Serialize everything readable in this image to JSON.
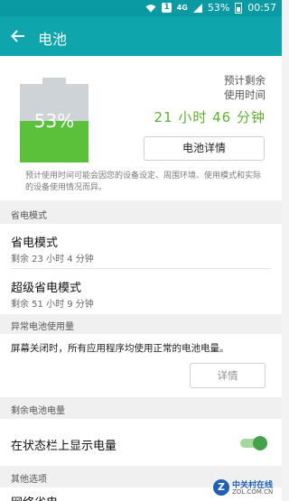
{
  "status_bar": {
    "sim": "1",
    "network": "4G",
    "battery": "53%",
    "time": "00:57"
  },
  "app_bar": {
    "title": "电池"
  },
  "battery": {
    "level_percent": 53,
    "percent_label": "53%",
    "remaining_label": "预计剩余\n使用时间",
    "remaining_time": "21 小时 46 分钟",
    "detail_button": "电池详情",
    "notice": "预计使用时间可能会因您的设备设定、周围环境、使用模式和实际的设备使用情况而异。",
    "fill_color": "#5cc13a"
  },
  "power_saving": {
    "header": "省电模式",
    "items": [
      {
        "title": "省电模式",
        "subtitle": "剩余 23 小时 4 分钟"
      },
      {
        "title": "超级省电模式",
        "subtitle": "剩余 51 小时 9 分钟"
      }
    ]
  },
  "abnormal": {
    "header": "异常电池使用量",
    "text": "屏幕关闭时，所有应用程序均使用正常的电池电量。",
    "button": "详情"
  },
  "remaining_power": {
    "header": "剩余电池电量",
    "item": "在状态栏上显示电量",
    "toggle_on": true
  },
  "other": {
    "header": "其他选项",
    "item": "网络省电"
  },
  "watermark": {
    "logo": "Z",
    "name": "中关村在线",
    "url": "ZOL.COM.CN"
  },
  "colors": {
    "accent": "#0ea5ac",
    "green": "#5cb22e"
  }
}
